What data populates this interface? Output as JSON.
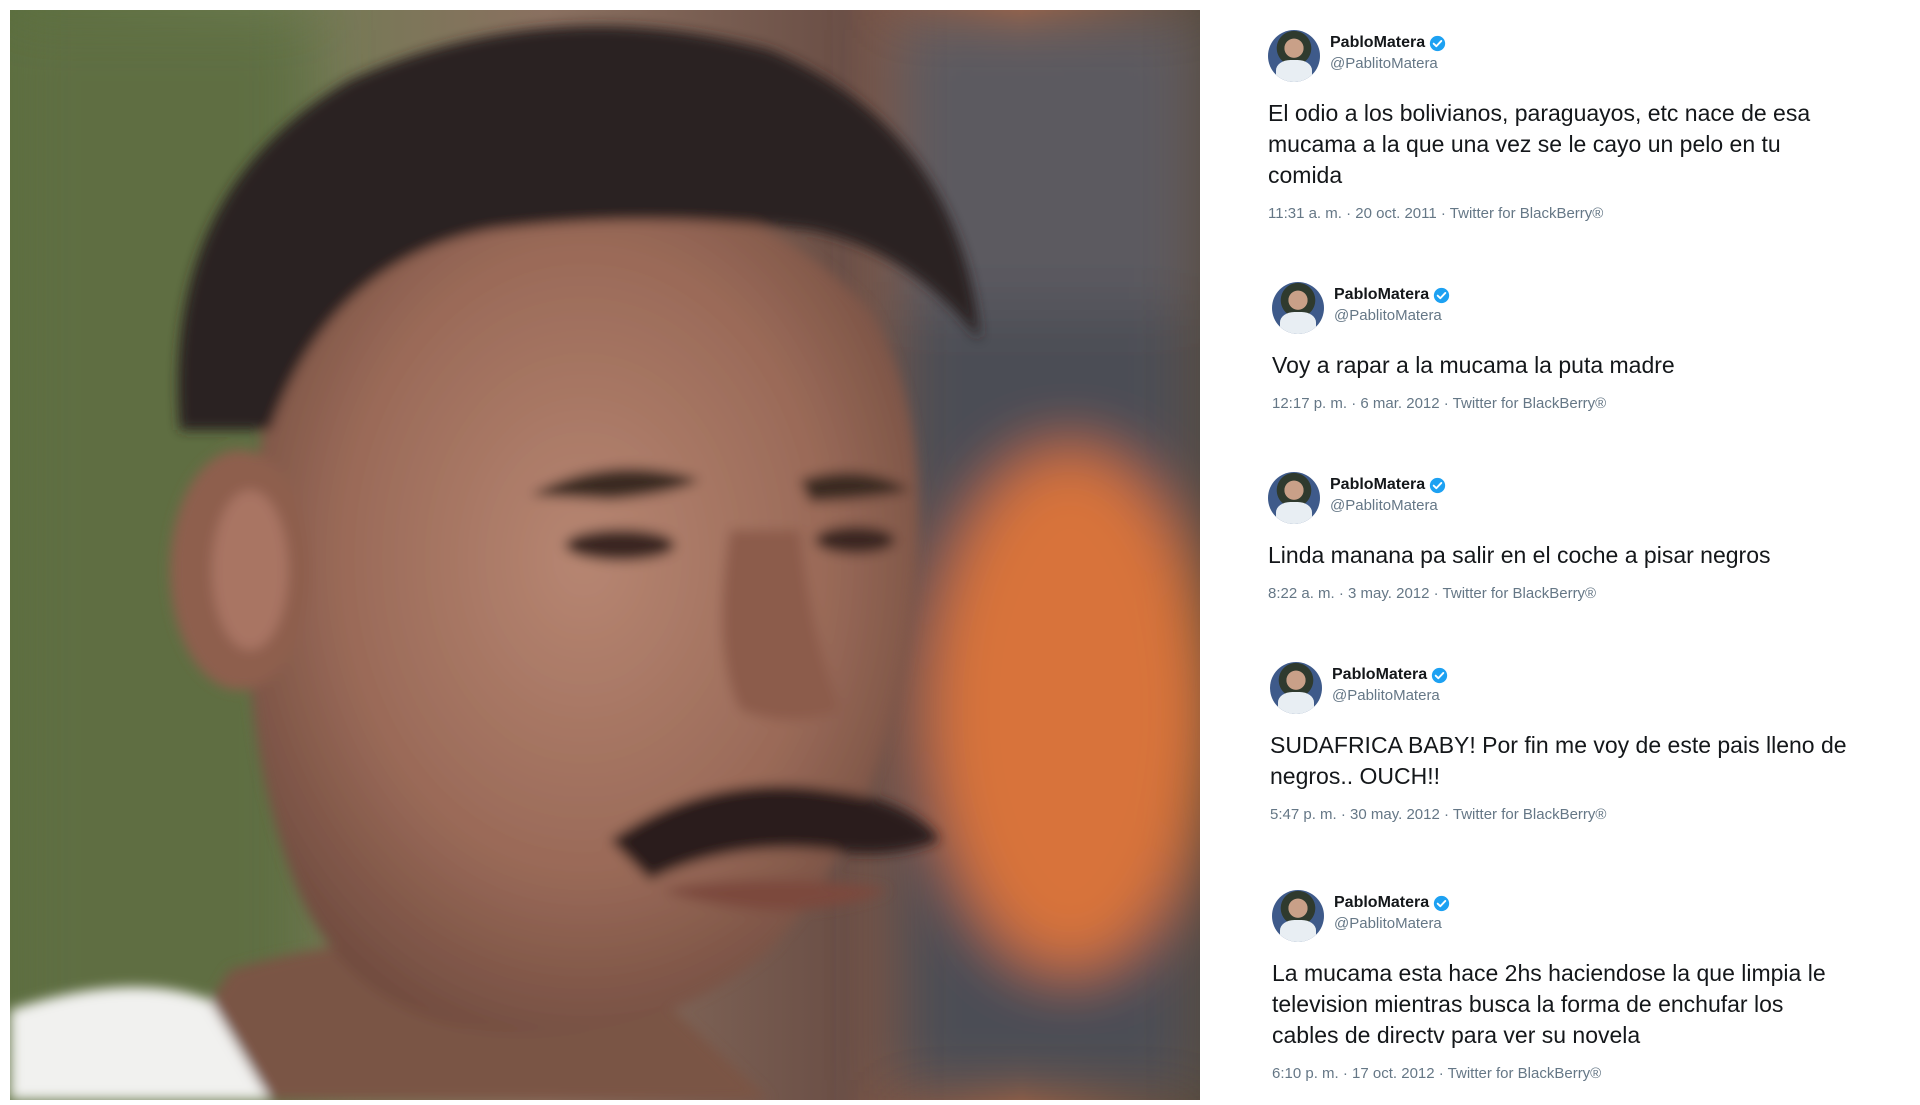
{
  "tweets": [
    {
      "display_name": "PabloMatera",
      "handle": "@PablitoMatera",
      "text": "El odio a los bolivianos, paraguayos, etc nace de esa\nmucama a la que una vez se le cayo un pelo en tu\ncomida",
      "meta": "11:31 a. m. · 20 oct. 2011 · Twitter for BlackBerry®"
    },
    {
      "display_name": "PabloMatera",
      "handle": "@PablitoMatera",
      "text": "Voy a rapar a la mucama la puta madre",
      "meta": "12:17 p. m. · 6 mar. 2012 · Twitter for BlackBerry®"
    },
    {
      "display_name": "PabloMatera",
      "handle": "@PablitoMatera",
      "text": "Linda manana pa salir en el coche a pisar negros",
      "meta": "8:22 a. m. · 3 may. 2012 · Twitter for BlackBerry®"
    },
    {
      "display_name": "PabloMatera",
      "handle": "@PablitoMatera",
      "text": "SUDAFRICA BABY! Por fin me voy de este pais lleno de\nnegros.. OUCH!!",
      "meta": "5:47 p. m. · 30 may. 2012 · Twitter for BlackBerry®"
    },
    {
      "display_name": "PabloMatera",
      "handle": "@PablitoMatera",
      "text": "La mucama esta hace 2hs haciendose la que limpia le\ntelevision mientras busca la forma de enchufar los\ncables de directv para ver su novela",
      "meta": "6:10 p. m. · 17 oct. 2012 · Twitter for BlackBerry®"
    }
  ],
  "colors": {
    "verified": "#1da1f2",
    "name": "#14171a",
    "secondary": "#657786"
  }
}
